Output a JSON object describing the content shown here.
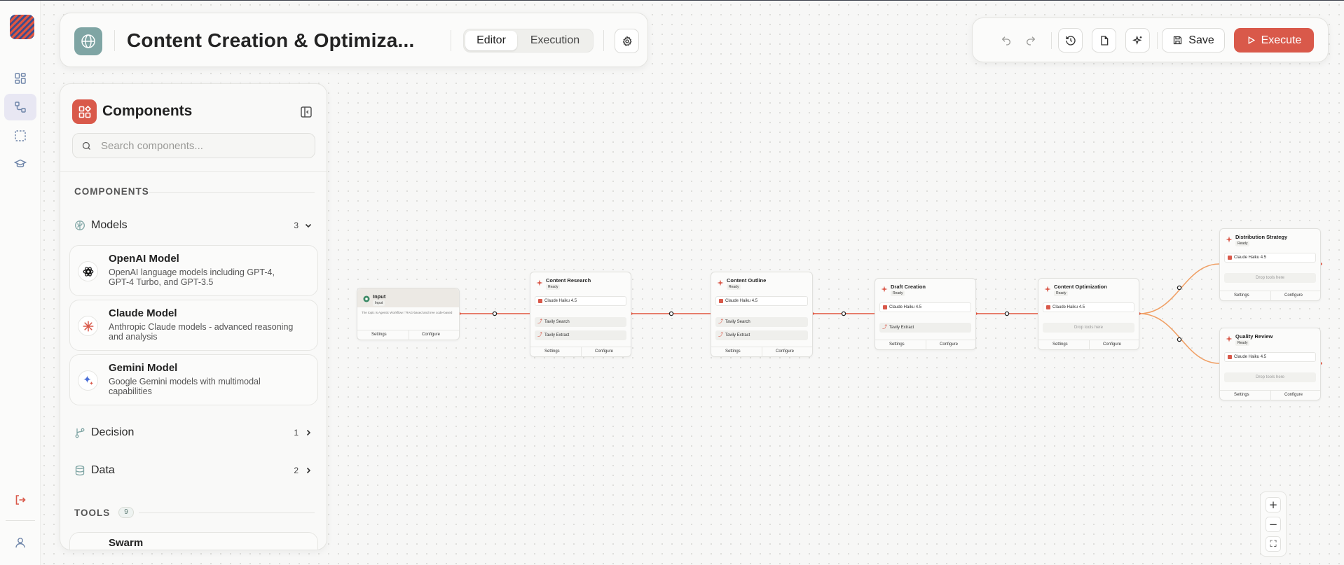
{
  "header": {
    "title": "Content Creation & Optimiza...",
    "tabs": [
      {
        "label": "Editor",
        "active": true
      },
      {
        "label": "Execution",
        "active": false
      }
    ]
  },
  "toolbar": {
    "save_label": "Save",
    "execute_label": "Execute"
  },
  "panel": {
    "title": "Components",
    "search_placeholder": "Search components...",
    "section_components": "COMPONENTS",
    "section_tools": "TOOLS",
    "tools_count": "9",
    "categories": [
      {
        "label": "Models",
        "count": "3",
        "icon": "brain-icon",
        "expanded": true
      },
      {
        "label": "Decision",
        "count": "1",
        "icon": "branch-icon",
        "expanded": false
      },
      {
        "label": "Data",
        "count": "2",
        "icon": "database-icon",
        "expanded": false
      }
    ],
    "models": [
      {
        "title": "OpenAI Model",
        "desc": "OpenAI language models including GPT-4, GPT-4 Turbo, and GPT-3.5",
        "icon": "openai-icon"
      },
      {
        "title": "Claude Model",
        "desc": "Anthropic Claude models - advanced reasoning and analysis",
        "icon": "claude-icon"
      },
      {
        "title": "Gemini Model",
        "desc": "Google Gemini models with multimodal capabilities",
        "icon": "gemini-icon"
      }
    ],
    "tools": [
      {
        "title": "Swarm"
      }
    ]
  },
  "workflow": {
    "settings_label": "Settings",
    "configure_label": "Configure",
    "status_ready": "Ready",
    "drop_tools": "Drop tools here",
    "model_name": "Claude Haiku 4.5",
    "input_node": {
      "title": "Input",
      "tag": "Input",
      "desc": "The topic is Agentic Workflow / 'RAG-based and tree code-based"
    },
    "nodes": [
      {
        "title": "Content Research",
        "tools": [
          "Tavily Search",
          "Tavily Extract"
        ]
      },
      {
        "title": "Content Outline",
        "tools": [
          "Tavily Search",
          "Tavily Extract"
        ]
      },
      {
        "title": "Draft Creation",
        "tools": [
          "Tavily Extract"
        ]
      },
      {
        "title": "Content Optimization",
        "tools": []
      },
      {
        "title": "Distribution Strategy",
        "tools": []
      },
      {
        "title": "Quality Review",
        "tools": []
      }
    ]
  },
  "zoom": {
    "in": "+",
    "out": "−",
    "fit": "⛶"
  },
  "colors": {
    "accent": "#d9594a",
    "edge": "#e2553f",
    "edge_branch": "#f0a066",
    "globe": "#7fa5a4"
  }
}
